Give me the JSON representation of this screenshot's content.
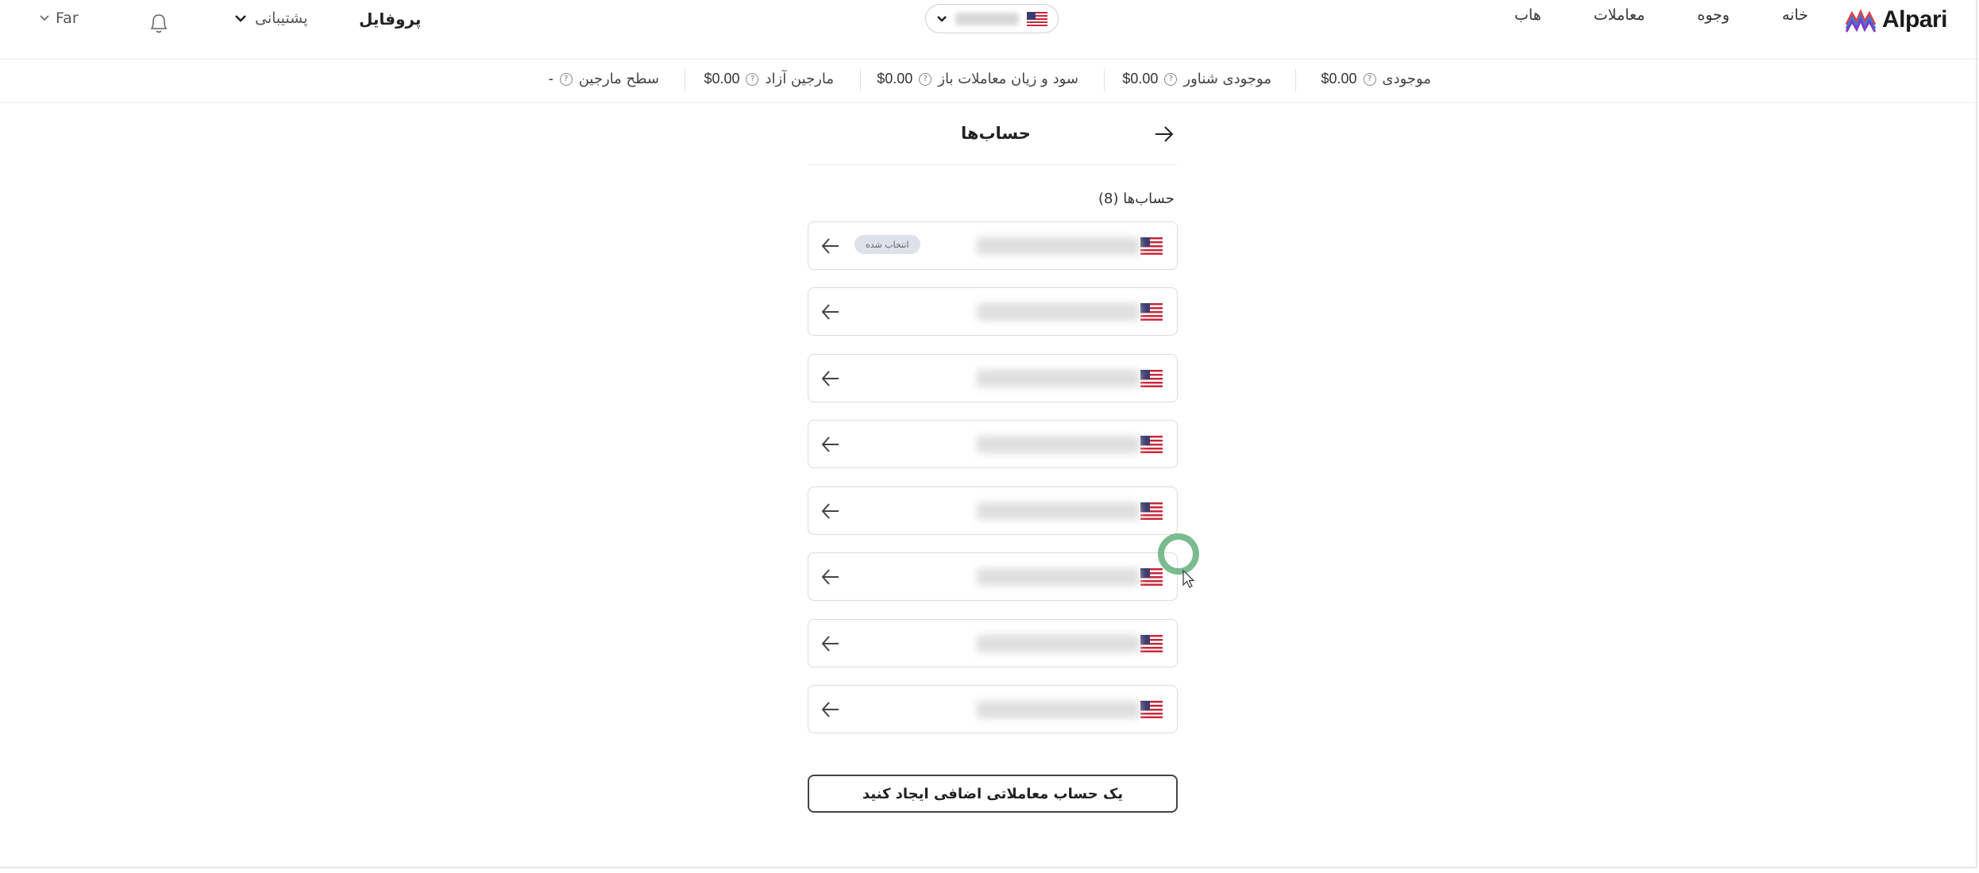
{
  "colors": {
    "accent_ring": "#6aaf7d",
    "border": "#dcdcdc",
    "badge_bg": "#dfe1ea"
  },
  "header": {
    "logo": "Alpari",
    "nav": [
      "خانه",
      "وجوه",
      "معاملات",
      "هاب"
    ],
    "profile": "پروفایل",
    "support": "پشتیبانی",
    "language": "Far"
  },
  "metrics": [
    {
      "label": "موجودی",
      "value": "$0.00"
    },
    {
      "label": "موجودی شناور",
      "value": "$0.00"
    },
    {
      "label": "سود و زیان معاملات باز",
      "value": "$0.00"
    },
    {
      "label": "مارجین آزاد",
      "value": "$0.00"
    },
    {
      "label": "سطح مارجین",
      "value": "-"
    }
  ],
  "page": {
    "title": "حساب‌ها",
    "count_label": "حساب‌ها (8)"
  },
  "accounts": [
    {
      "badge": "انتخاب شده"
    },
    {
      "badge": ""
    },
    {
      "badge": ""
    },
    {
      "badge": ""
    },
    {
      "badge": ""
    },
    {
      "badge": ""
    },
    {
      "badge": ""
    },
    {
      "badge": ""
    }
  ],
  "create_button": "یک حساب معاملاتی اضافی ایجاد کنید"
}
